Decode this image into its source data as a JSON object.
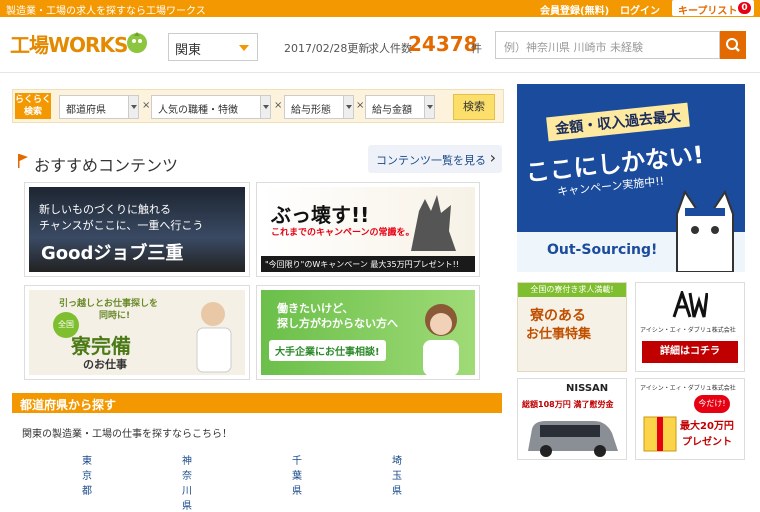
{
  "topbar": {
    "tagline": "製造業・工場の求人を探すなら工場ワークス",
    "register": "会員登録(無料)",
    "login": "ログイン",
    "keeplist": "キープリスト",
    "keep_count": "0"
  },
  "header": {
    "logo": "工場WORKS",
    "region": "関東",
    "updated": "2017/02/28更新",
    "count_label": "求人件数",
    "count": "24378",
    "count_unit": "件",
    "search_placeholder": "例）神奈川県 川崎市 未経験"
  },
  "quick": {
    "label1": "らくらく",
    "label2": "検索",
    "selects": [
      "都道府県",
      "人気の職種・特徴",
      "給与形態",
      "給与金額"
    ],
    "times": "×",
    "button": "検索"
  },
  "recommend": {
    "title": "おすすめコンテンツ",
    "see_all": "コンテンツ一覧を見る"
  },
  "banners": {
    "b1": {
      "line1": "新しいものづくりに触れる",
      "line2": "チャンスがここに、一重へ行こう",
      "main": "Goodジョブ三重"
    },
    "b2": {
      "main": "ぶっ壊す!!",
      "sub": "これまでのキャンペーンの常識を。",
      "footer": "\"今回限り\"のWキャンペーン 最大35万円プレゼント!!"
    },
    "b3": {
      "line1": "引っ越しとお仕事探しを",
      "line2": "同時に!",
      "badge": "全国",
      "main": "寮完備",
      "sub": "のお仕事"
    },
    "b4": {
      "line1": "働きたいけど、",
      "line2": "探し方がわからない方へ",
      "main": "大手企業にお仕事相談!"
    }
  },
  "section": {
    "title": "都道府県から探す",
    "sub": "関東の製造業・工場の仕事を探すならこちら！",
    "prefs": [
      "東京都",
      "神奈川県",
      "千葉県",
      "埼玉県"
    ]
  },
  "ads": {
    "ad1": {
      "line1": "金額・収入過去最大",
      "line2": "ここにしかない!",
      "line3": "キャンペーン実施中!!",
      "brand": "Out-Sourcing!"
    },
    "ad2": {
      "top": "全国の寮付き求人満載!",
      "main1": "寮のある",
      "main2": "お仕事特集"
    },
    "ad3": {
      "company": "アイシン・エィ・ダブリュ株式会社",
      "link": "詳細はコチラ"
    },
    "ad4": {
      "brand": "NISSAN",
      "line": "総額108万円 満了慰労金"
    },
    "ad5": {
      "company": "アイシン・エィ・ダブリュ株式会社",
      "line1": "今だけ!",
      "line2": "最大20万円",
      "line3": "プレゼント"
    }
  }
}
